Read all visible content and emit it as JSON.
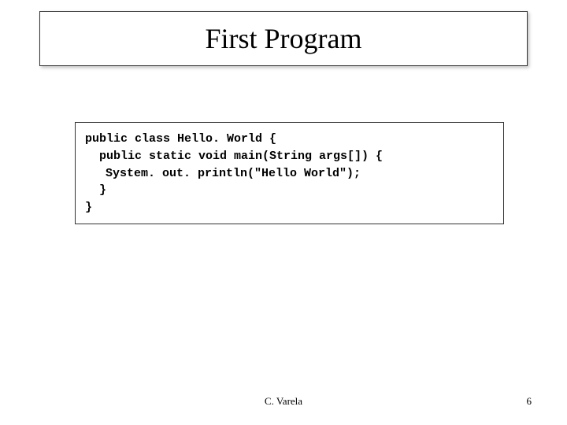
{
  "title": "First Program",
  "code": {
    "line1": "public class Hello. World {",
    "line2": "public static void main(String args[]) {",
    "line3": "System. out. println(\"Hello World\");",
    "line4": "}",
    "line5": "}"
  },
  "footer": {
    "author": "C. Varela",
    "page": "6"
  }
}
